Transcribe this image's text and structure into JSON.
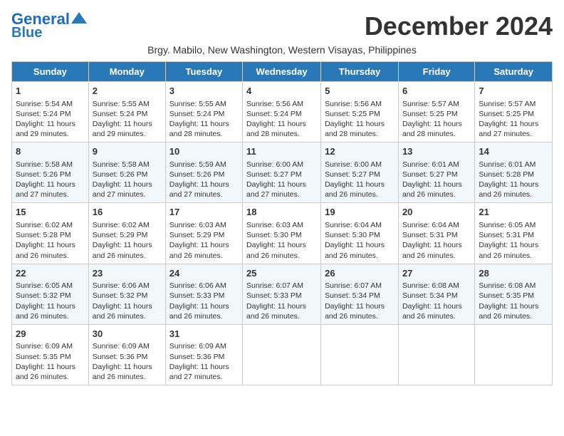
{
  "header": {
    "logo_line1": "General",
    "logo_line2": "Blue",
    "month_title": "December 2024",
    "subtitle": "Brgy. Mabilo, New Washington, Western Visayas, Philippines"
  },
  "days_of_week": [
    "Sunday",
    "Monday",
    "Tuesday",
    "Wednesday",
    "Thursday",
    "Friday",
    "Saturday"
  ],
  "weeks": [
    [
      {
        "day": "1",
        "sunrise": "Sunrise: 5:54 AM",
        "sunset": "Sunset: 5:24 PM",
        "daylight": "Daylight: 11 hours and 29 minutes."
      },
      {
        "day": "2",
        "sunrise": "Sunrise: 5:55 AM",
        "sunset": "Sunset: 5:24 PM",
        "daylight": "Daylight: 11 hours and 29 minutes."
      },
      {
        "day": "3",
        "sunrise": "Sunrise: 5:55 AM",
        "sunset": "Sunset: 5:24 PM",
        "daylight": "Daylight: 11 hours and 28 minutes."
      },
      {
        "day": "4",
        "sunrise": "Sunrise: 5:56 AM",
        "sunset": "Sunset: 5:24 PM",
        "daylight": "Daylight: 11 hours and 28 minutes."
      },
      {
        "day": "5",
        "sunrise": "Sunrise: 5:56 AM",
        "sunset": "Sunset: 5:25 PM",
        "daylight": "Daylight: 11 hours and 28 minutes."
      },
      {
        "day": "6",
        "sunrise": "Sunrise: 5:57 AM",
        "sunset": "Sunset: 5:25 PM",
        "daylight": "Daylight: 11 hours and 28 minutes."
      },
      {
        "day": "7",
        "sunrise": "Sunrise: 5:57 AM",
        "sunset": "Sunset: 5:25 PM",
        "daylight": "Daylight: 11 hours and 27 minutes."
      }
    ],
    [
      {
        "day": "8",
        "sunrise": "Sunrise: 5:58 AM",
        "sunset": "Sunset: 5:26 PM",
        "daylight": "Daylight: 11 hours and 27 minutes."
      },
      {
        "day": "9",
        "sunrise": "Sunrise: 5:58 AM",
        "sunset": "Sunset: 5:26 PM",
        "daylight": "Daylight: 11 hours and 27 minutes."
      },
      {
        "day": "10",
        "sunrise": "Sunrise: 5:59 AM",
        "sunset": "Sunset: 5:26 PM",
        "daylight": "Daylight: 11 hours and 27 minutes."
      },
      {
        "day": "11",
        "sunrise": "Sunrise: 6:00 AM",
        "sunset": "Sunset: 5:27 PM",
        "daylight": "Daylight: 11 hours and 27 minutes."
      },
      {
        "day": "12",
        "sunrise": "Sunrise: 6:00 AM",
        "sunset": "Sunset: 5:27 PM",
        "daylight": "Daylight: 11 hours and 26 minutes."
      },
      {
        "day": "13",
        "sunrise": "Sunrise: 6:01 AM",
        "sunset": "Sunset: 5:27 PM",
        "daylight": "Daylight: 11 hours and 26 minutes."
      },
      {
        "day": "14",
        "sunrise": "Sunrise: 6:01 AM",
        "sunset": "Sunset: 5:28 PM",
        "daylight": "Daylight: 11 hours and 26 minutes."
      }
    ],
    [
      {
        "day": "15",
        "sunrise": "Sunrise: 6:02 AM",
        "sunset": "Sunset: 5:28 PM",
        "daylight": "Daylight: 11 hours and 26 minutes."
      },
      {
        "day": "16",
        "sunrise": "Sunrise: 6:02 AM",
        "sunset": "Sunset: 5:29 PM",
        "daylight": "Daylight: 11 hours and 26 minutes."
      },
      {
        "day": "17",
        "sunrise": "Sunrise: 6:03 AM",
        "sunset": "Sunset: 5:29 PM",
        "daylight": "Daylight: 11 hours and 26 minutes."
      },
      {
        "day": "18",
        "sunrise": "Sunrise: 6:03 AM",
        "sunset": "Sunset: 5:30 PM",
        "daylight": "Daylight: 11 hours and 26 minutes."
      },
      {
        "day": "19",
        "sunrise": "Sunrise: 6:04 AM",
        "sunset": "Sunset: 5:30 PM",
        "daylight": "Daylight: 11 hours and 26 minutes."
      },
      {
        "day": "20",
        "sunrise": "Sunrise: 6:04 AM",
        "sunset": "Sunset: 5:31 PM",
        "daylight": "Daylight: 11 hours and 26 minutes."
      },
      {
        "day": "21",
        "sunrise": "Sunrise: 6:05 AM",
        "sunset": "Sunset: 5:31 PM",
        "daylight": "Daylight: 11 hours and 26 minutes."
      }
    ],
    [
      {
        "day": "22",
        "sunrise": "Sunrise: 6:05 AM",
        "sunset": "Sunset: 5:32 PM",
        "daylight": "Daylight: 11 hours and 26 minutes."
      },
      {
        "day": "23",
        "sunrise": "Sunrise: 6:06 AM",
        "sunset": "Sunset: 5:32 PM",
        "daylight": "Daylight: 11 hours and 26 minutes."
      },
      {
        "day": "24",
        "sunrise": "Sunrise: 6:06 AM",
        "sunset": "Sunset: 5:33 PM",
        "daylight": "Daylight: 11 hours and 26 minutes."
      },
      {
        "day": "25",
        "sunrise": "Sunrise: 6:07 AM",
        "sunset": "Sunset: 5:33 PM",
        "daylight": "Daylight: 11 hours and 26 minutes."
      },
      {
        "day": "26",
        "sunrise": "Sunrise: 6:07 AM",
        "sunset": "Sunset: 5:34 PM",
        "daylight": "Daylight: 11 hours and 26 minutes."
      },
      {
        "day": "27",
        "sunrise": "Sunrise: 6:08 AM",
        "sunset": "Sunset: 5:34 PM",
        "daylight": "Daylight: 11 hours and 26 minutes."
      },
      {
        "day": "28",
        "sunrise": "Sunrise: 6:08 AM",
        "sunset": "Sunset: 5:35 PM",
        "daylight": "Daylight: 11 hours and 26 minutes."
      }
    ],
    [
      {
        "day": "29",
        "sunrise": "Sunrise: 6:09 AM",
        "sunset": "Sunset: 5:35 PM",
        "daylight": "Daylight: 11 hours and 26 minutes."
      },
      {
        "day": "30",
        "sunrise": "Sunrise: 6:09 AM",
        "sunset": "Sunset: 5:36 PM",
        "daylight": "Daylight: 11 hours and 26 minutes."
      },
      {
        "day": "31",
        "sunrise": "Sunrise: 6:09 AM",
        "sunset": "Sunset: 5:36 PM",
        "daylight": "Daylight: 11 hours and 27 minutes."
      },
      null,
      null,
      null,
      null
    ]
  ]
}
